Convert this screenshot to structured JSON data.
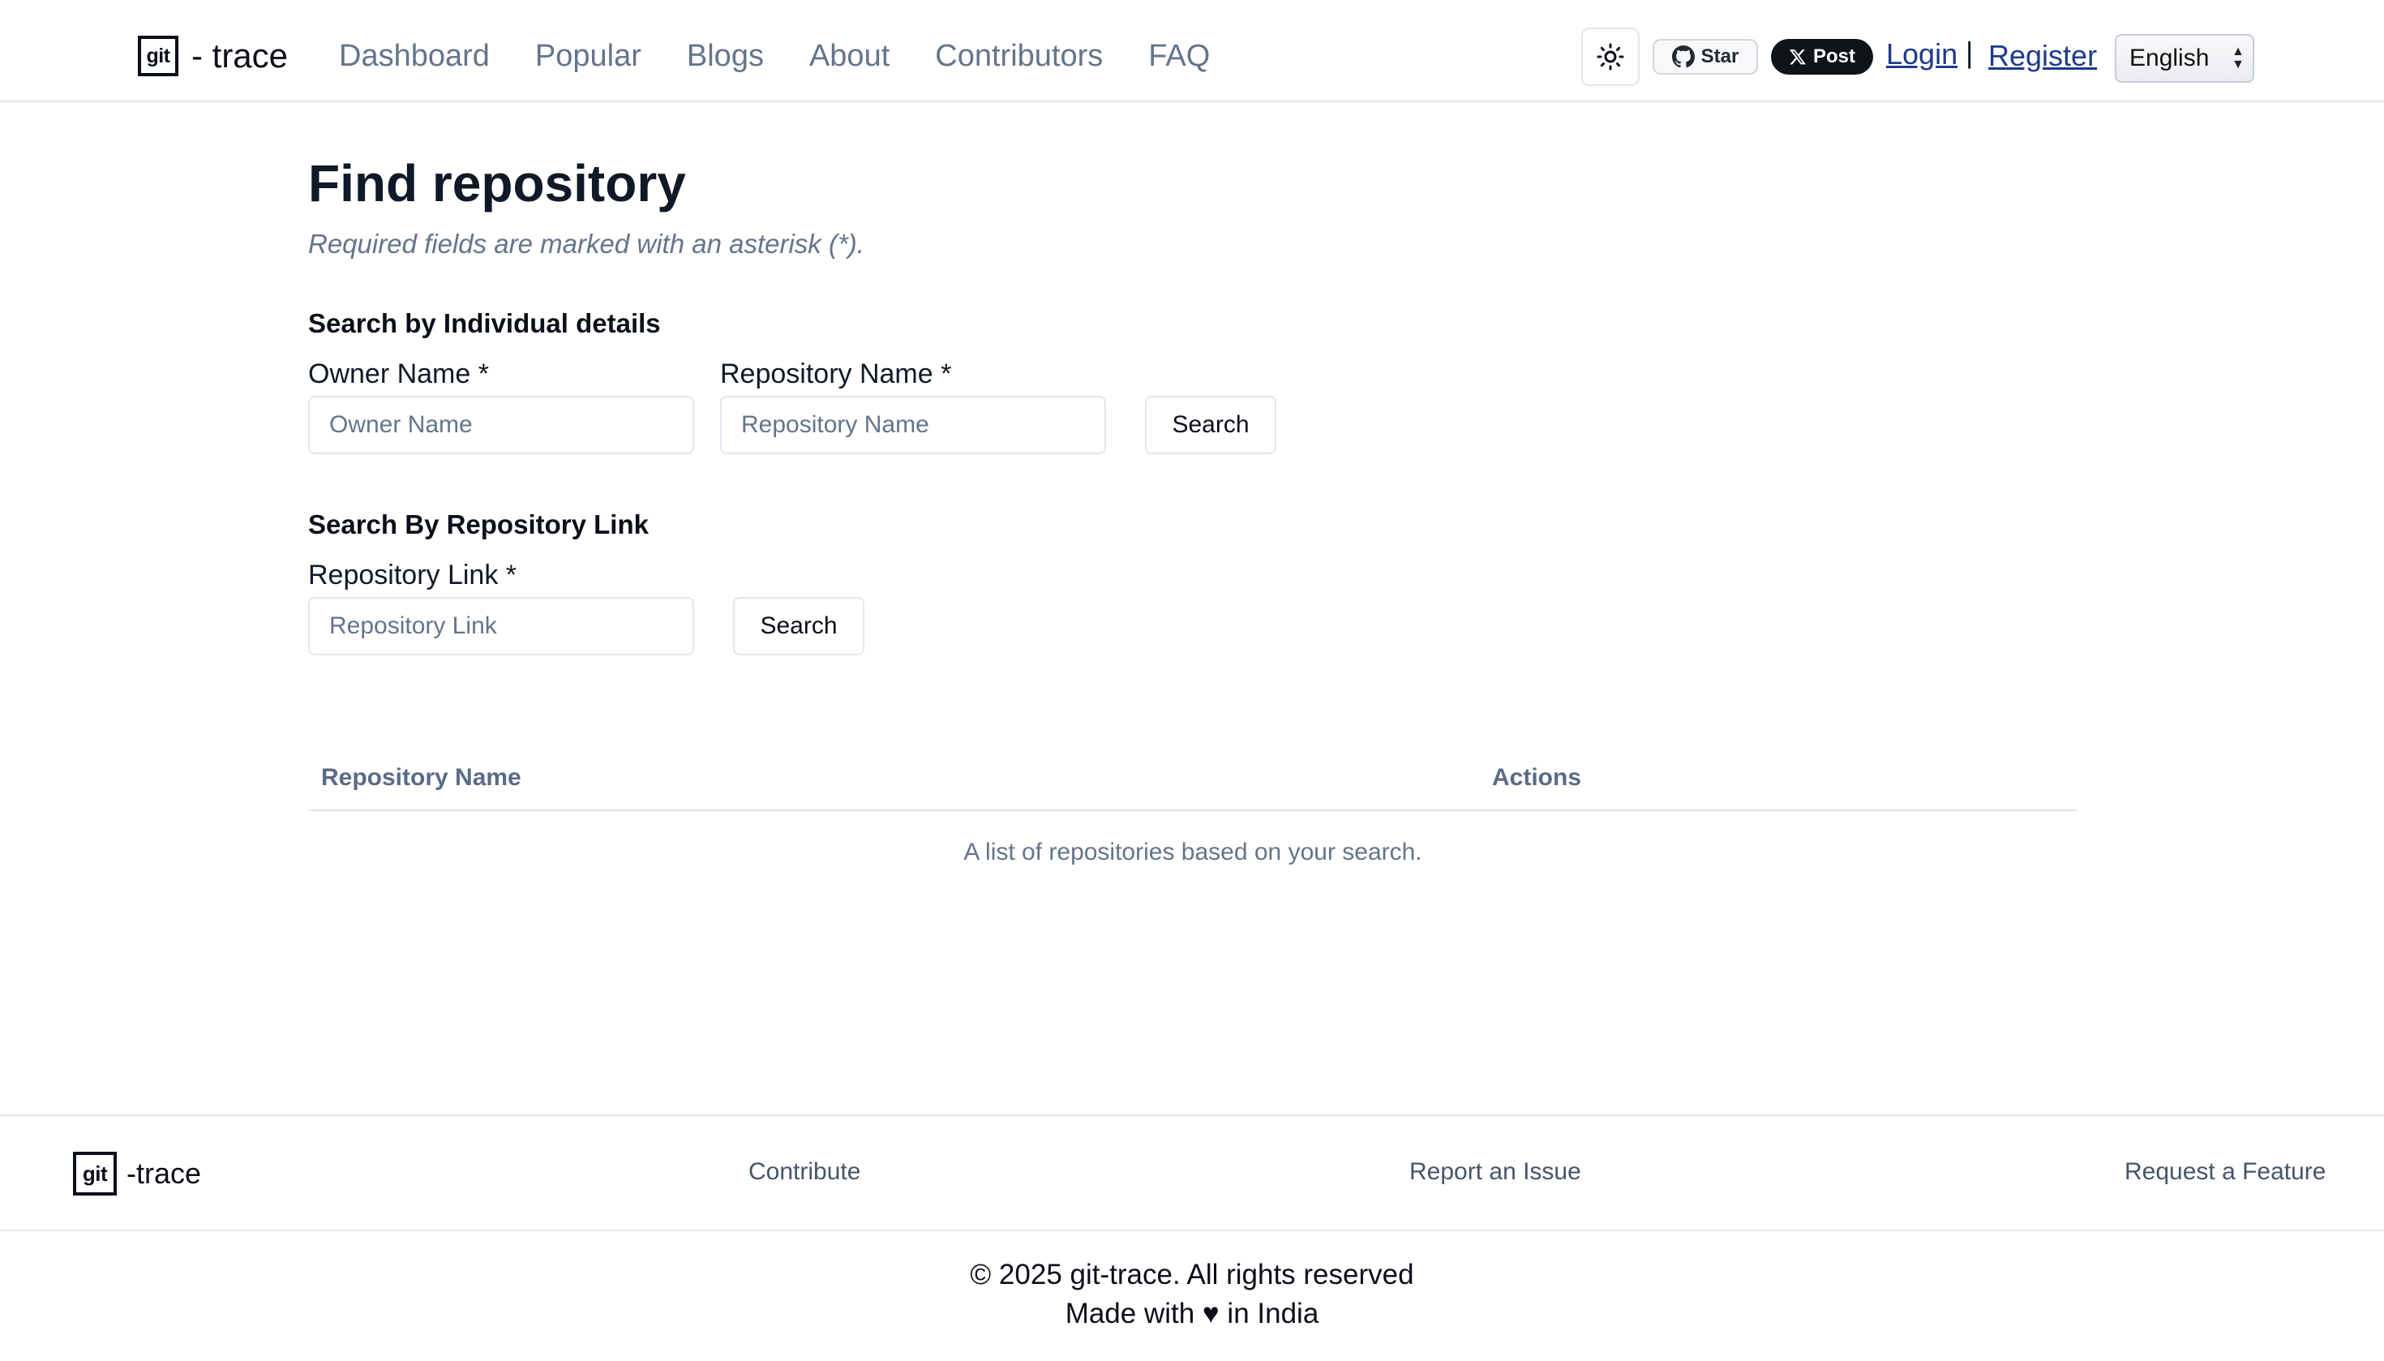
{
  "header": {
    "logo_mark": "git",
    "logo_text": "- trace",
    "nav": [
      {
        "label": "Dashboard"
      },
      {
        "label": "Popular"
      },
      {
        "label": "Blogs"
      },
      {
        "label": "About"
      },
      {
        "label": "Contributors"
      },
      {
        "label": "FAQ"
      }
    ],
    "theme_icon": "sun-icon",
    "github_star_label": "Star",
    "x_post_label": "Post",
    "login_label": "Login",
    "separator": "|",
    "register_label": "Register",
    "language": "English"
  },
  "main": {
    "title": "Find repository",
    "subtitle": "Required fields are marked with an asterisk (*).",
    "individual": {
      "heading": "Search by Individual details",
      "owner_label": "Owner Name *",
      "owner_placeholder": "Owner Name",
      "owner_value": "",
      "repo_label": "Repository Name *",
      "repo_placeholder": "Repository Name",
      "repo_value": "",
      "search_label": "Search"
    },
    "link": {
      "heading": "Search By Repository Link",
      "link_label": "Repository Link *",
      "link_placeholder": "Repository Link",
      "link_value": "",
      "search_label": "Search"
    },
    "table": {
      "columns": [
        "Repository Name",
        "Actions"
      ],
      "caption": "A list of repositories based on your search."
    }
  },
  "footer": {
    "logo_mark": "git",
    "logo_text": "-trace",
    "links": [
      "Contribute",
      "Report an Issue",
      "Request a Feature"
    ],
    "copyright": "© 2025 git-trace. All rights reserved",
    "made_with": "Made with ♥ in India"
  },
  "colors": {
    "text": "#0f172a",
    "muted": "#64748b",
    "link_blue": "#1e3a8a",
    "border": "#e2e8f0"
  }
}
